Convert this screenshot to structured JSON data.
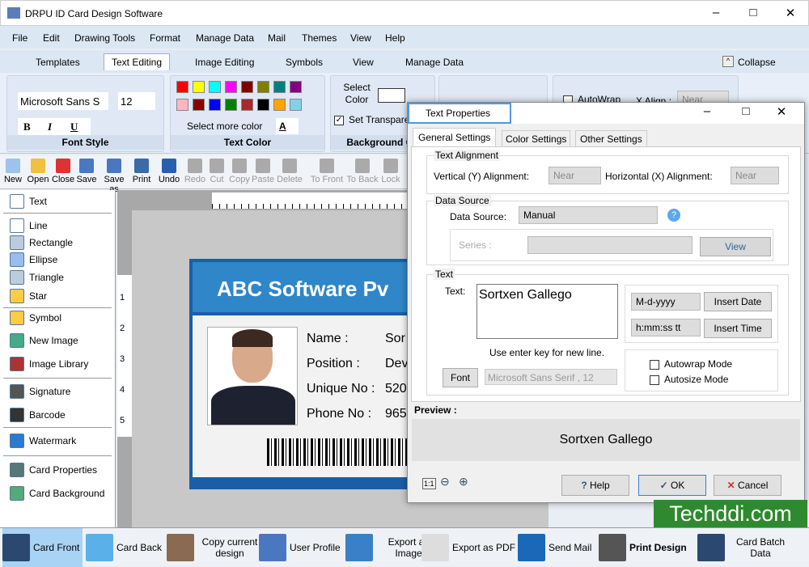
{
  "app": {
    "title": "DRPU ID Card Design Software"
  },
  "menu": [
    "File",
    "Edit",
    "Drawing Tools",
    "Format",
    "Manage Data",
    "Mail",
    "Themes",
    "View",
    "Help"
  ],
  "ribbon_tabs": [
    "Templates",
    "Text Editing",
    "Image Editing",
    "Symbols",
    "View",
    "Manage Data"
  ],
  "collapse_label": "Collapse",
  "font_style": {
    "font": "Microsoft Sans S",
    "size": "12",
    "bold": "B",
    "italic": "I",
    "underline": "U",
    "caption": "Font Style"
  },
  "text_color": {
    "caption": "Text Color",
    "more": "Select more color",
    "a_label": "A",
    "swatches": [
      "#ff0000",
      "#ffff00",
      "#00ffff",
      "#ff00ff",
      "#800000",
      "#808000",
      "#008080",
      "#800080",
      "#ffb6c1",
      "#8b0000",
      "#0000ff",
      "#008000",
      "#a52a2a",
      "#000000",
      "#ffa500",
      "#87ceeb"
    ]
  },
  "background": {
    "select_color": "Select Color",
    "transparent": "Set Transparent",
    "caption": "Background Co"
  },
  "ribbon_right": {
    "autowrap": "AutoWrap",
    "xalign": "X Align :",
    "xalign_value": "Near"
  },
  "toolbar": [
    {
      "label": "New",
      "enabled": true
    },
    {
      "label": "Open",
      "enabled": true
    },
    {
      "label": "Close",
      "enabled": true
    },
    {
      "label": "Save",
      "enabled": true
    },
    {
      "label": "Save as",
      "enabled": true
    },
    {
      "label": "Print",
      "enabled": true
    },
    {
      "label": "Undo",
      "enabled": true
    },
    {
      "label": "Redo",
      "enabled": false
    },
    {
      "label": "Cut",
      "enabled": false
    },
    {
      "label": "Copy",
      "enabled": false
    },
    {
      "label": "Paste",
      "enabled": false
    },
    {
      "label": "Delete",
      "enabled": false
    },
    {
      "label": "To Front",
      "enabled": false
    },
    {
      "label": "To Back",
      "enabled": false
    },
    {
      "label": "Lock",
      "enabled": false
    }
  ],
  "tools": [
    "Text",
    "Line",
    "Rectangle",
    "Ellipse",
    "Triangle",
    "Star",
    "Symbol",
    "New Image",
    "Image Library",
    "Signature",
    "Barcode",
    "Watermark",
    "Card Properties",
    "Card Background"
  ],
  "ruler_left": [
    "1",
    "2",
    "3",
    "4",
    "5"
  ],
  "card": {
    "company": "ABC Software Pv",
    "labels": [
      "Name :",
      "Position :",
      "Unique No :",
      "Phone No :"
    ],
    "values": [
      "Sor",
      "Dev",
      "520",
      "965"
    ]
  },
  "dialog": {
    "title": "Text Properties",
    "tabs": [
      "General Settings",
      "Color Settings",
      "Other Settings"
    ],
    "text_alignment": "Text Alignment",
    "vertical_label": "Vertical (Y) Alignment:",
    "vertical_value": "Near",
    "horizontal_label": "Horizontal (X) Alignment:",
    "horizontal_value": "Near",
    "data_source_group": "Data Source",
    "data_source_label": "Data Source:",
    "data_source_value": "Manual",
    "series_label": "Series :",
    "view": "View",
    "text_group": "Text",
    "text_label": "Text:",
    "text_value": "Sortxen Gallego",
    "date_format": "M-d-yyyy",
    "insert_date": "Insert Date",
    "time_format": "h:mm:ss tt",
    "insert_time": "Insert Time",
    "hint": "Use enter key for new line.",
    "font_button": "Font",
    "font_value": "Microsoft Sans Serif , 12",
    "autowrap": "Autowrap Mode",
    "autosize": "Autosize Mode",
    "preview_label": "Preview :",
    "preview_text": "Sortxen Gallego",
    "help": "Help",
    "ok": "OK",
    "cancel": "Cancel",
    "zoom_reset": "1:1"
  },
  "bottom": [
    "Card Front",
    "Card Back",
    "Copy current design",
    "User Profile",
    "Export as Image",
    "Export as PDF",
    "Send Mail",
    "Print Design",
    "Card Batch Data"
  ],
  "watermark": "Techddi.com"
}
